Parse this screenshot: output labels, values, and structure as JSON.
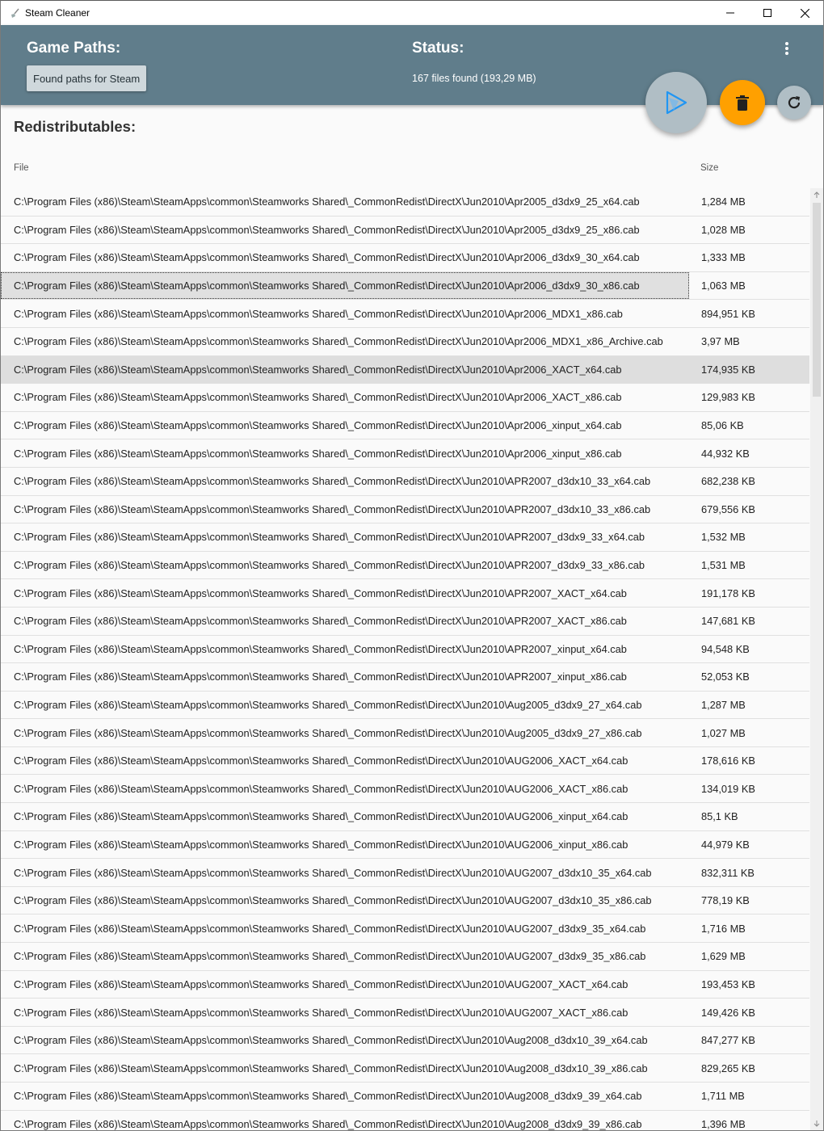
{
  "window": {
    "title": "Steam Cleaner"
  },
  "header": {
    "game_paths_title": "Game Paths:",
    "found_paths_button": "Found paths for Steam",
    "status_title": "Status:",
    "status_text": "167 files found (193,29 MB)"
  },
  "colors": {
    "header": "#607d8b",
    "delete_fab": "#ffa000",
    "fab_grey": "#b0bec5"
  },
  "icons": {
    "app": "broom-icon",
    "minimize": "minimize-icon",
    "maximize": "maximize-icon",
    "close": "close-icon",
    "menu": "more-vertical-icon",
    "play": "play-icon",
    "delete": "trash-icon",
    "refresh": "refresh-icon"
  },
  "section": {
    "title": "Redistributables:"
  },
  "table": {
    "columns": {
      "file": "File",
      "size": "Size"
    },
    "rows": [
      {
        "file": "C:\\Program Files (x86)\\Steam\\SteamApps\\common\\Steamworks Shared\\_CommonRedist\\DirectX\\Jun2010\\Apr2005_d3dx9_25_x64.cab",
        "size": "1,284 MB"
      },
      {
        "file": "C:\\Program Files (x86)\\Steam\\SteamApps\\common\\Steamworks Shared\\_CommonRedist\\DirectX\\Jun2010\\Apr2005_d3dx9_25_x86.cab",
        "size": "1,028 MB"
      },
      {
        "file": "C:\\Program Files (x86)\\Steam\\SteamApps\\common\\Steamworks Shared\\_CommonRedist\\DirectX\\Jun2010\\Apr2006_d3dx9_30_x64.cab",
        "size": "1,333 MB"
      },
      {
        "file": "C:\\Program Files (x86)\\Steam\\SteamApps\\common\\Steamworks Shared\\_CommonRedist\\DirectX\\Jun2010\\Apr2006_d3dx9_30_x86.cab",
        "size": "1,063 MB"
      },
      {
        "file": "C:\\Program Files (x86)\\Steam\\SteamApps\\common\\Steamworks Shared\\_CommonRedist\\DirectX\\Jun2010\\Apr2006_MDX1_x86.cab",
        "size": "894,951 KB"
      },
      {
        "file": "C:\\Program Files (x86)\\Steam\\SteamApps\\common\\Steamworks Shared\\_CommonRedist\\DirectX\\Jun2010\\Apr2006_MDX1_x86_Archive.cab",
        "size": "3,97 MB"
      },
      {
        "file": "C:\\Program Files (x86)\\Steam\\SteamApps\\common\\Steamworks Shared\\_CommonRedist\\DirectX\\Jun2010\\Apr2006_XACT_x64.cab",
        "size": "174,935 KB"
      },
      {
        "file": "C:\\Program Files (x86)\\Steam\\SteamApps\\common\\Steamworks Shared\\_CommonRedist\\DirectX\\Jun2010\\Apr2006_XACT_x86.cab",
        "size": "129,983 KB"
      },
      {
        "file": "C:\\Program Files (x86)\\Steam\\SteamApps\\common\\Steamworks Shared\\_CommonRedist\\DirectX\\Jun2010\\Apr2006_xinput_x64.cab",
        "size": "85,06 KB"
      },
      {
        "file": "C:\\Program Files (x86)\\Steam\\SteamApps\\common\\Steamworks Shared\\_CommonRedist\\DirectX\\Jun2010\\Apr2006_xinput_x86.cab",
        "size": "44,932 KB"
      },
      {
        "file": "C:\\Program Files (x86)\\Steam\\SteamApps\\common\\Steamworks Shared\\_CommonRedist\\DirectX\\Jun2010\\APR2007_d3dx10_33_x64.cab",
        "size": "682,238 KB"
      },
      {
        "file": "C:\\Program Files (x86)\\Steam\\SteamApps\\common\\Steamworks Shared\\_CommonRedist\\DirectX\\Jun2010\\APR2007_d3dx10_33_x86.cab",
        "size": "679,556 KB"
      },
      {
        "file": "C:\\Program Files (x86)\\Steam\\SteamApps\\common\\Steamworks Shared\\_CommonRedist\\DirectX\\Jun2010\\APR2007_d3dx9_33_x64.cab",
        "size": "1,532 MB"
      },
      {
        "file": "C:\\Program Files (x86)\\Steam\\SteamApps\\common\\Steamworks Shared\\_CommonRedist\\DirectX\\Jun2010\\APR2007_d3dx9_33_x86.cab",
        "size": "1,531 MB"
      },
      {
        "file": "C:\\Program Files (x86)\\Steam\\SteamApps\\common\\Steamworks Shared\\_CommonRedist\\DirectX\\Jun2010\\APR2007_XACT_x64.cab",
        "size": "191,178 KB"
      },
      {
        "file": "C:\\Program Files (x86)\\Steam\\SteamApps\\common\\Steamworks Shared\\_CommonRedist\\DirectX\\Jun2010\\APR2007_XACT_x86.cab",
        "size": "147,681 KB"
      },
      {
        "file": "C:\\Program Files (x86)\\Steam\\SteamApps\\common\\Steamworks Shared\\_CommonRedist\\DirectX\\Jun2010\\APR2007_xinput_x64.cab",
        "size": "94,548 KB"
      },
      {
        "file": "C:\\Program Files (x86)\\Steam\\SteamApps\\common\\Steamworks Shared\\_CommonRedist\\DirectX\\Jun2010\\APR2007_xinput_x86.cab",
        "size": "52,053 KB"
      },
      {
        "file": "C:\\Program Files (x86)\\Steam\\SteamApps\\common\\Steamworks Shared\\_CommonRedist\\DirectX\\Jun2010\\Aug2005_d3dx9_27_x64.cab",
        "size": "1,287 MB"
      },
      {
        "file": "C:\\Program Files (x86)\\Steam\\SteamApps\\common\\Steamworks Shared\\_CommonRedist\\DirectX\\Jun2010\\Aug2005_d3dx9_27_x86.cab",
        "size": "1,027 MB"
      },
      {
        "file": "C:\\Program Files (x86)\\Steam\\SteamApps\\common\\Steamworks Shared\\_CommonRedist\\DirectX\\Jun2010\\AUG2006_XACT_x64.cab",
        "size": "178,616 KB"
      },
      {
        "file": "C:\\Program Files (x86)\\Steam\\SteamApps\\common\\Steamworks Shared\\_CommonRedist\\DirectX\\Jun2010\\AUG2006_XACT_x86.cab",
        "size": "134,019 KB"
      },
      {
        "file": "C:\\Program Files (x86)\\Steam\\SteamApps\\common\\Steamworks Shared\\_CommonRedist\\DirectX\\Jun2010\\AUG2006_xinput_x64.cab",
        "size": "85,1 KB"
      },
      {
        "file": "C:\\Program Files (x86)\\Steam\\SteamApps\\common\\Steamworks Shared\\_CommonRedist\\DirectX\\Jun2010\\AUG2006_xinput_x86.cab",
        "size": "44,979 KB"
      },
      {
        "file": "C:\\Program Files (x86)\\Steam\\SteamApps\\common\\Steamworks Shared\\_CommonRedist\\DirectX\\Jun2010\\AUG2007_d3dx10_35_x64.cab",
        "size": "832,311 KB"
      },
      {
        "file": "C:\\Program Files (x86)\\Steam\\SteamApps\\common\\Steamworks Shared\\_CommonRedist\\DirectX\\Jun2010\\AUG2007_d3dx10_35_x86.cab",
        "size": "778,19 KB"
      },
      {
        "file": "C:\\Program Files (x86)\\Steam\\SteamApps\\common\\Steamworks Shared\\_CommonRedist\\DirectX\\Jun2010\\AUG2007_d3dx9_35_x64.cab",
        "size": "1,716 MB"
      },
      {
        "file": "C:\\Program Files (x86)\\Steam\\SteamApps\\common\\Steamworks Shared\\_CommonRedist\\DirectX\\Jun2010\\AUG2007_d3dx9_35_x86.cab",
        "size": "1,629 MB"
      },
      {
        "file": "C:\\Program Files (x86)\\Steam\\SteamApps\\common\\Steamworks Shared\\_CommonRedist\\DirectX\\Jun2010\\AUG2007_XACT_x64.cab",
        "size": "193,453 KB"
      },
      {
        "file": "C:\\Program Files (x86)\\Steam\\SteamApps\\common\\Steamworks Shared\\_CommonRedist\\DirectX\\Jun2010\\AUG2007_XACT_x86.cab",
        "size": "149,426 KB"
      },
      {
        "file": "C:\\Program Files (x86)\\Steam\\SteamApps\\common\\Steamworks Shared\\_CommonRedist\\DirectX\\Jun2010\\Aug2008_d3dx10_39_x64.cab",
        "size": "847,277 KB"
      },
      {
        "file": "C:\\Program Files (x86)\\Steam\\SteamApps\\common\\Steamworks Shared\\_CommonRedist\\DirectX\\Jun2010\\Aug2008_d3dx10_39_x86.cab",
        "size": "829,265 KB"
      },
      {
        "file": "C:\\Program Files (x86)\\Steam\\SteamApps\\common\\Steamworks Shared\\_CommonRedist\\DirectX\\Jun2010\\Aug2008_d3dx9_39_x64.cab",
        "size": "1,711 MB"
      },
      {
        "file": "C:\\Program Files (x86)\\Steam\\SteamApps\\common\\Steamworks Shared\\_CommonRedist\\DirectX\\Jun2010\\Aug2008_d3dx9_39_x86.cab",
        "size": "1,396 MB"
      }
    ]
  }
}
